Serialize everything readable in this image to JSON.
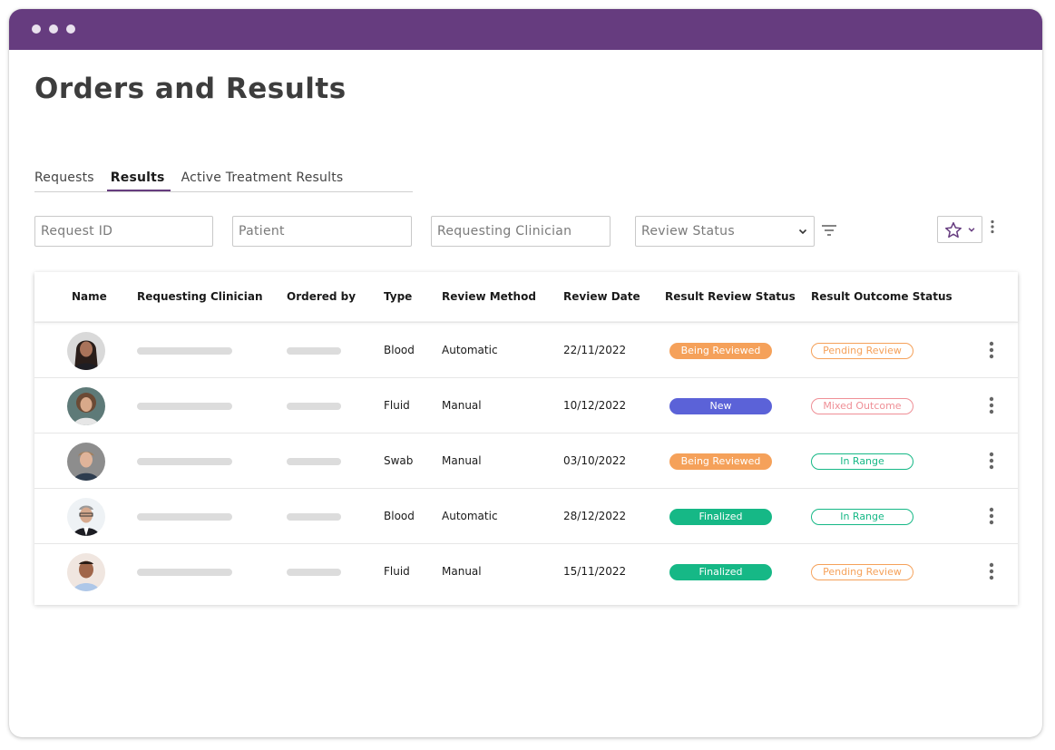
{
  "page": {
    "title": "Orders and Results"
  },
  "tabs": [
    {
      "label": "Requests",
      "active": false
    },
    {
      "label": "Results",
      "active": true
    },
    {
      "label": "Active Treatment Results",
      "active": false
    }
  ],
  "filters": {
    "request_id_placeholder": "Request ID",
    "patient_placeholder": "Patient",
    "clinician_placeholder": "Requesting Clinician",
    "review_status_label": "Review Status",
    "icons": {
      "filter": "filter-icon",
      "favorite": "star-icon",
      "more": "more-vertical-icon"
    }
  },
  "table": {
    "headers": [
      "Name",
      "Requesting Clinician",
      "Ordered by",
      "Type",
      "Review Method",
      "Review Date",
      "Result Review Status",
      "Result Outcome Status"
    ],
    "rows": [
      {
        "type": "Blood",
        "method": "Automatic",
        "date": "22/11/2022",
        "review_status": "Being Reviewed",
        "outcome_status": "Pending Review"
      },
      {
        "type": "Fluid",
        "method": "Manual",
        "date": "10/12/2022",
        "review_status": "New",
        "outcome_status": "Mixed Outcome"
      },
      {
        "type": "Swab",
        "method": "Manual",
        "date": "03/10/2022",
        "review_status": "Being Reviewed",
        "outcome_status": "In Range"
      },
      {
        "type": "Blood",
        "method": "Automatic",
        "date": "28/12/2022",
        "review_status": "Finalized",
        "outcome_status": "In Range"
      },
      {
        "type": "Fluid",
        "method": "Manual",
        "date": "15/11/2022",
        "review_status": "Finalized",
        "outcome_status": "Pending Review"
      }
    ]
  },
  "colors": {
    "brand": "#663c7f",
    "being_reviewed": "#f5a15a",
    "new": "#5b62d8",
    "finalized": "#16b886",
    "pending_review": "#f5a15a",
    "mixed_outcome": "#ef8f96",
    "in_range": "#16b886"
  }
}
